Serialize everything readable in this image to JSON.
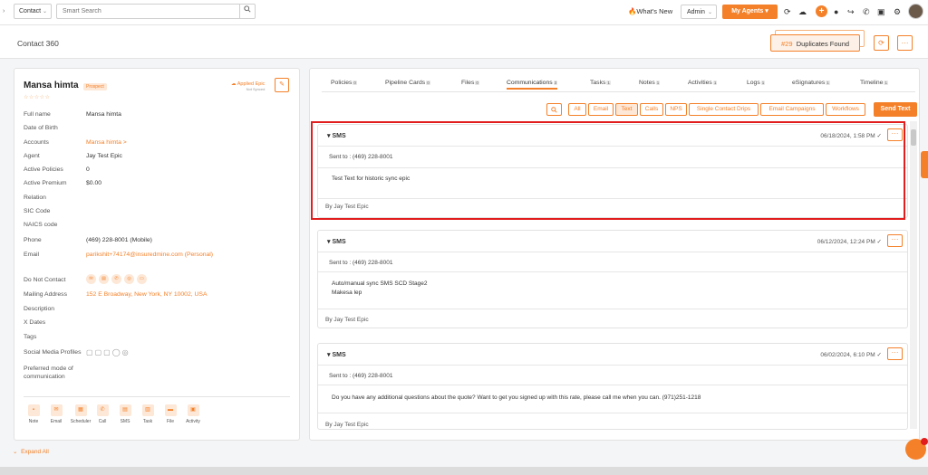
{
  "topbar": {
    "contact_select": "Contact",
    "search_placeholder": "Smart Search",
    "whats_new": "What's New",
    "admin_select": "Admin",
    "my_agents": "My Agents"
  },
  "page": {
    "title": "Contact 360",
    "duplicates_number": "#29",
    "duplicates_label": "Duplicates Found"
  },
  "contact": {
    "name": "Mansa himta",
    "status_badge": "Prospect",
    "stars": "☆☆☆☆☆",
    "applied_label": "Applied Epic",
    "applied_sub": "Not Synced",
    "fields": [
      {
        "label": "Full name",
        "value": "Mansa himta"
      },
      {
        "label": "Date of Birth",
        "value": ""
      },
      {
        "label": "Accounts",
        "value": "Mansa himta >"
      },
      {
        "label": "Agent",
        "value": "Jay Test Epic"
      },
      {
        "label": "Active Policies",
        "value": "0"
      },
      {
        "label": "Active Premium",
        "value": "$0.00"
      },
      {
        "label": "Relation",
        "value": ""
      },
      {
        "label": "SIC Code",
        "value": ""
      },
      {
        "label": "NAICS code",
        "value": ""
      },
      {
        "label": "Phone",
        "value": "(469) 228-8001 (Mobile)"
      },
      {
        "label": "Email",
        "value": "parikshit+74174@insuredmine.com  (Personal)"
      },
      {
        "label": "Do Not Contact",
        "value": ""
      },
      {
        "label": "Mailing Address",
        "value": "152 E Broadway, New York, NY 10002, USA"
      },
      {
        "label": "Description",
        "value": ""
      },
      {
        "label": "X Dates",
        "value": ""
      },
      {
        "label": "Tags",
        "value": ""
      },
      {
        "label": "Social Media Profiles",
        "value": ""
      },
      {
        "label": "Preferred mode of",
        "value": ""
      },
      {
        "label": "communication",
        "value": ""
      }
    ],
    "quick_actions": [
      "Note",
      "Email",
      "Scheduler",
      "Call",
      "SMS",
      "Task",
      "File",
      "Activity"
    ],
    "expand_all": "Expand All"
  },
  "tabs": [
    {
      "label": "Policies",
      "count": "0"
    },
    {
      "label": "Pipeline Cards",
      "count": "0"
    },
    {
      "label": "Files",
      "count": "0"
    },
    {
      "label": "Communications",
      "count": "3"
    },
    {
      "label": "Tasks",
      "count": "1"
    },
    {
      "label": "Notes",
      "count": "1"
    },
    {
      "label": "Activities",
      "count": "1"
    },
    {
      "label": "Logs",
      "count": "1"
    },
    {
      "label": "eSignatures",
      "count": "1"
    },
    {
      "label": "Timeline",
      "count": "1"
    }
  ],
  "filters": [
    "All",
    "Email",
    "Text",
    "Calls",
    "NPS",
    "Single Contact Drips",
    "Email Campaigns",
    "Workflows"
  ],
  "send_text": "Send Text",
  "messages": [
    {
      "type": "SMS",
      "date": "06/18/2024, 1:58 PM",
      "sent_to": "Sent to : (469) 228-8001",
      "body": [
        "Test Text for historic sync epic"
      ],
      "by": "By Jay Test Epic"
    },
    {
      "type": "SMS",
      "date": "06/12/2024, 12:24 PM",
      "sent_to": "Sent to : (469) 228-8001",
      "body": [
        "Auto/manual sync SMS SCD Stage2",
        "Makesa lep"
      ],
      "by": "By Jay Test Epic"
    },
    {
      "type": "SMS",
      "date": "06/02/2024, 6:10 PM",
      "sent_to": "Sent to : (469) 228-8001",
      "body": [
        "Do you have any additional questions about the quote? Want to get you signed up with this rate, please call me when you can. (971)251-1218"
      ],
      "by": "By Jay Test Epic"
    }
  ],
  "colors": {
    "accent": "#f4812a",
    "highlight": "#e21d1d"
  }
}
